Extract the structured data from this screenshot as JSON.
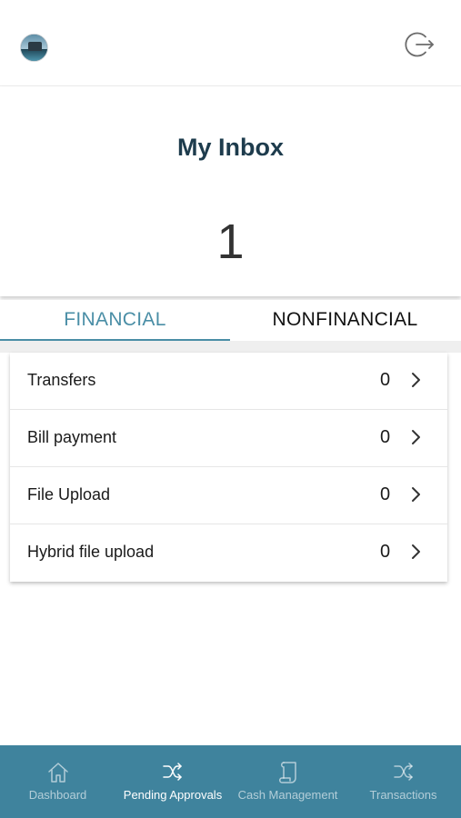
{
  "header": {
    "avatar_icon": "profile-photo",
    "logout_icon": "logout-icon"
  },
  "inbox": {
    "title": "My Inbox",
    "count": "1"
  },
  "tabs": [
    {
      "label": "FINANCIAL",
      "active": true
    },
    {
      "label": "NONFINANCIAL",
      "active": false
    }
  ],
  "items": [
    {
      "label": "Transfers",
      "count": "0"
    },
    {
      "label": "Bill payment",
      "count": "0"
    },
    {
      "label": "File Upload",
      "count": "0"
    },
    {
      "label": "Hybrid file upload",
      "count": "0"
    }
  ],
  "bottom_nav": [
    {
      "label": "Dashboard",
      "icon": "home-icon",
      "active": false
    },
    {
      "label": "Pending Approvals",
      "icon": "shuffle-icon",
      "active": true
    },
    {
      "label": "Cash Management",
      "icon": "scroll-icon",
      "active": false
    },
    {
      "label": "Transactions",
      "icon": "shuffle-icon",
      "active": false
    }
  ],
  "colors": {
    "accent": "#4a8ea6",
    "nav_background": "#3f839d",
    "title": "#1e3c4d"
  }
}
